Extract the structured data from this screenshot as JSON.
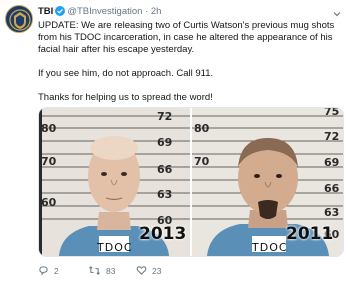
{
  "tweet": {
    "author_name": "TBI",
    "handle": "@TBInvestigation",
    "separator": "·",
    "time": "2h",
    "paragraphs": [
      "UPDATE: We are releasing two of Curtis Watson's previous mug shots from his TDOC incarceration, in case he altered the appearance of his facial hair after his escape yesterday.",
      "If you see him, do not approach. Call 911.",
      "Thanks for helping us to spread the word!"
    ]
  },
  "media": {
    "left": {
      "ruler_labels": [
        "72",
        "80",
        "69",
        "70",
        "66",
        "63",
        "60",
        "60"
      ],
      "year": "2013",
      "tag": "TDOC"
    },
    "right": {
      "ruler_labels": [
        "75",
        "72",
        "80",
        "70",
        "69",
        "66",
        "63",
        "60"
      ],
      "year": "2011",
      "tag": "TDOC"
    }
  },
  "actions": {
    "replies": "2",
    "retweets": "83",
    "likes": "23"
  },
  "icons": {
    "avatar": "tbi-badge-icon",
    "verified": "verified-badge-icon",
    "more": "chevron-down-icon",
    "reply": "reply-icon",
    "retweet": "retweet-icon",
    "like": "heart-icon"
  },
  "colors": {
    "verified": "#1da1f2",
    "muted": "#657786",
    "text": "#14171a"
  }
}
